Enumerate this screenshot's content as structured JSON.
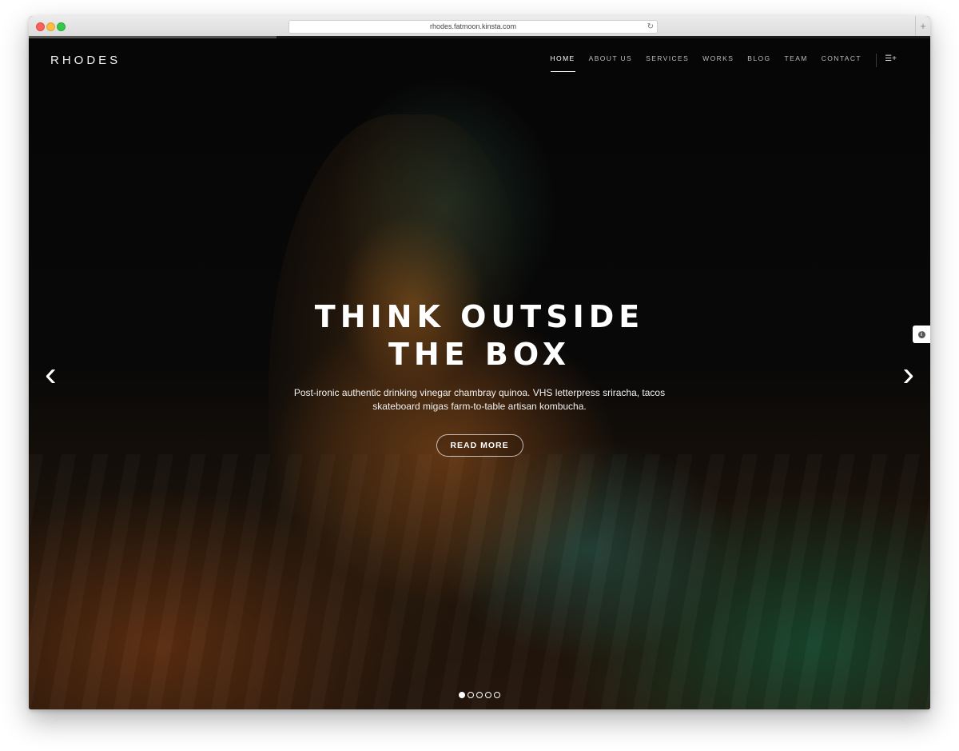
{
  "browser": {
    "url": "rhodes.fatmoon.kinsta.com",
    "reload_icon": "↻",
    "newtab_icon": "+"
  },
  "site": {
    "brand": "RHODES",
    "nav": [
      {
        "label": "HOME",
        "active": true
      },
      {
        "label": "ABOUT US",
        "active": false
      },
      {
        "label": "SERVICES",
        "active": false
      },
      {
        "label": "WORKS",
        "active": false
      },
      {
        "label": "BLOG",
        "active": false
      },
      {
        "label": "TEAM",
        "active": false
      },
      {
        "label": "CONTACT",
        "active": false
      }
    ],
    "menu_toggle_icon": "☰+"
  },
  "hero": {
    "title": "THINK OUTSIDE\nTHE BOX",
    "text": "Post-ironic authentic drinking vinegar chambray quinoa. VHS letterpress sriracha, tacos\nskateboard migas farm-to-table artisan kombucha.",
    "button": "READ MORE",
    "prev_icon": "‹",
    "next_icon": "›"
  },
  "side_tab": {
    "info_icon": "i"
  },
  "slider": {
    "count": 5,
    "active_index": 0
  }
}
